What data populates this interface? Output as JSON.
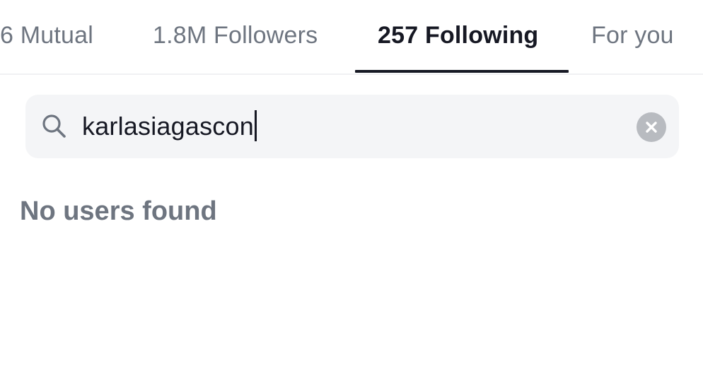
{
  "tabs": [
    {
      "label": "6 Mutual",
      "active": false
    },
    {
      "label": "1.8M Followers",
      "active": false
    },
    {
      "label": "257 Following",
      "active": true
    },
    {
      "label": "For you",
      "active": false
    }
  ],
  "search": {
    "value": "karlasiagascon",
    "icon": "search-icon",
    "clear_icon": "close-icon"
  },
  "results": {
    "empty_message": "No users found"
  },
  "colors": {
    "text_primary": "#161823",
    "text_secondary": "#6e7580",
    "search_bg": "#f4f5f7",
    "clear_bg": "#b8bbc0"
  }
}
